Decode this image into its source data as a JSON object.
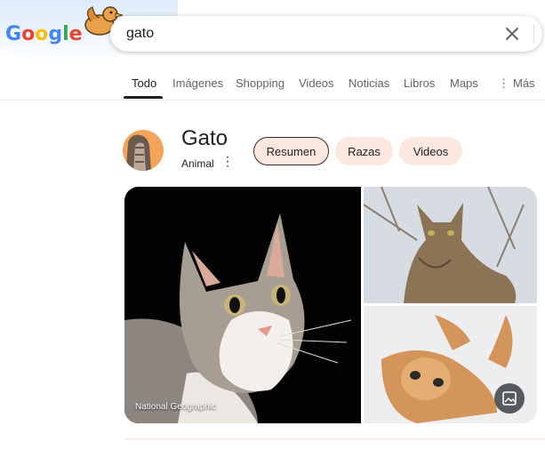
{
  "header": {
    "logo_letters": [
      "G",
      "o",
      "o",
      "g",
      "l",
      "e"
    ],
    "search_value": "gato"
  },
  "tabs": [
    {
      "label": "Todo",
      "active": true
    },
    {
      "label": "Imágenes"
    },
    {
      "label": "Shopping"
    },
    {
      "label": "Videos"
    },
    {
      "label": "Noticias"
    },
    {
      "label": "Libros"
    },
    {
      "label": "Maps"
    },
    {
      "label": "Más",
      "icon": "more-vert-icon"
    }
  ],
  "entity": {
    "title": "Gato",
    "subtitle": "Animal",
    "chips": [
      {
        "label": "Resumen",
        "selected": true
      },
      {
        "label": "Razas"
      },
      {
        "label": "Videos"
      }
    ]
  },
  "images": {
    "main_credit": "National Geographic"
  },
  "colors": {
    "chip_bg": "#fde8df",
    "tab_active": "#202124",
    "tab_inactive": "#5f6368"
  }
}
